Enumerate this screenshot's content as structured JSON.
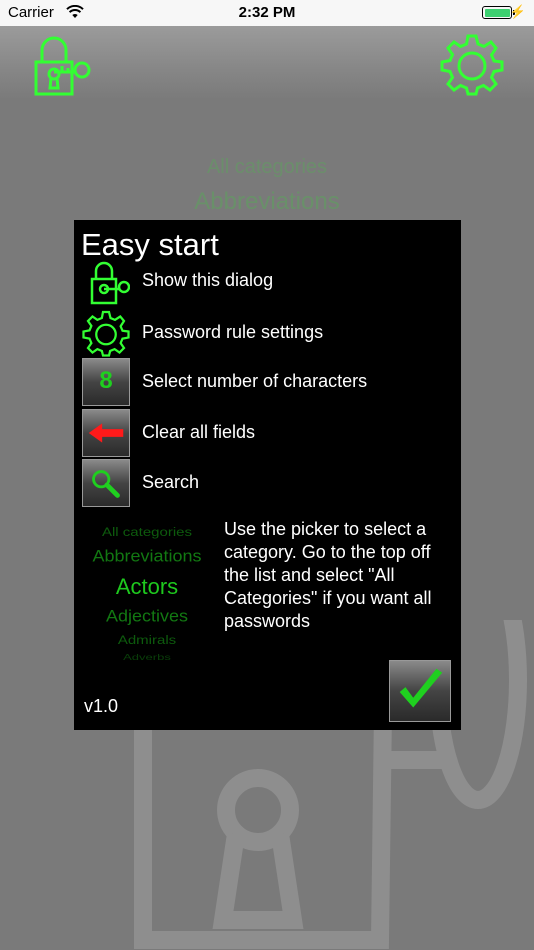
{
  "status_bar": {
    "carrier": "Carrier",
    "time": "2:32 PM"
  },
  "background": {
    "picker_items": [
      "All categories",
      "Abbreviations"
    ]
  },
  "dialog": {
    "title": "Easy start",
    "rows": [
      {
        "icon": "lock-key-icon",
        "label": "Show this dialog"
      },
      {
        "icon": "gear-icon",
        "label": "Password rule settings"
      },
      {
        "icon": "number-tile-icon",
        "digit": "8",
        "label": "Select number of characters"
      },
      {
        "icon": "left-arrow-icon",
        "label": "Clear all fields"
      },
      {
        "icon": "magnifier-icon",
        "label": "Search"
      }
    ],
    "picker": {
      "items": [
        "All categories",
        "Abbreviations",
        "Actors",
        "Adjectives",
        "Admirals",
        "Adverbs"
      ],
      "selected": "Actors"
    },
    "help_text": "Use the picker to select a category. Go to the top off the list and select \"All Categories\" if you want all passwords",
    "version": "v1.0"
  },
  "colors": {
    "accent_green": "#1fd01f",
    "dialog_bg": "#000000",
    "backdrop": "#7a7a7a"
  }
}
